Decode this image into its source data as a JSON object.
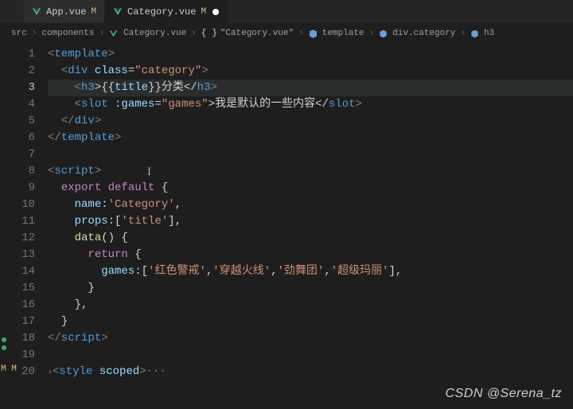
{
  "tabs": [
    {
      "name": "App.vue",
      "mod": "M",
      "active": false,
      "dot": false
    },
    {
      "name": "Category.vue",
      "mod": "M",
      "active": true,
      "dot": true
    }
  ],
  "breadcrumb": {
    "parts": [
      "src",
      "components",
      "Category.vue",
      "\"Category.vue\"",
      "template",
      "div.category",
      "h3"
    ]
  },
  "activeLine": 3,
  "lineCount": 20,
  "code": {
    "l1": {
      "tag_open": "<",
      "tag": "template",
      "tag_close": ">"
    },
    "l2": {
      "a": "<",
      "b": "div ",
      "c": "class",
      "d": "=",
      "e": "\"category\"",
      "f": ">"
    },
    "l3": {
      "a": "<",
      "b": "h3",
      "c": ">{{",
      "d": "title",
      "e": "}}分类</",
      "f": "h3",
      "g": ">"
    },
    "l4": {
      "a": "<",
      "b": "slot ",
      "c": ":games",
      "d": "=",
      "e": "\"games\"",
      "f": ">我是默认的一些内容</",
      "g": "slot",
      "h": ">"
    },
    "l5": {
      "a": "</",
      "b": "div",
      "c": ">"
    },
    "l6": {
      "a": "</",
      "b": "template",
      "c": ">"
    },
    "l8": {
      "a": "<",
      "b": "script",
      "c": ">"
    },
    "l9": {
      "a": "export default",
      "b": " {"
    },
    "l10": {
      "a": "name",
      "b": ":",
      "c": "'Category'",
      "d": ","
    },
    "l11": {
      "a": "props",
      "b": ":[",
      "c": "'title'",
      "d": "],"
    },
    "l12": {
      "a": "data",
      "b": "() {"
    },
    "l13": {
      "a": "return",
      "b": " {"
    },
    "l14": {
      "a": "games",
      "b": ":[",
      "c": "'红色警戒'",
      "d": ",",
      "e": "'穿越火线'",
      "f": ",",
      "g": "'劲舞团'",
      "h": ",",
      "i": "'超级玛丽'",
      "j": "],"
    },
    "l15": {
      "a": "}"
    },
    "l16": {
      "a": "},"
    },
    "l17": {
      "a": "}"
    },
    "l18": {
      "a": "</",
      "b": "script",
      "c": ">"
    },
    "l20": {
      "a": "<",
      "b": "style ",
      "c": "scoped",
      "d": ">",
      "e": "···"
    }
  },
  "watermark": "CSDN @Serena_tz",
  "leftMarks": "M\nM"
}
